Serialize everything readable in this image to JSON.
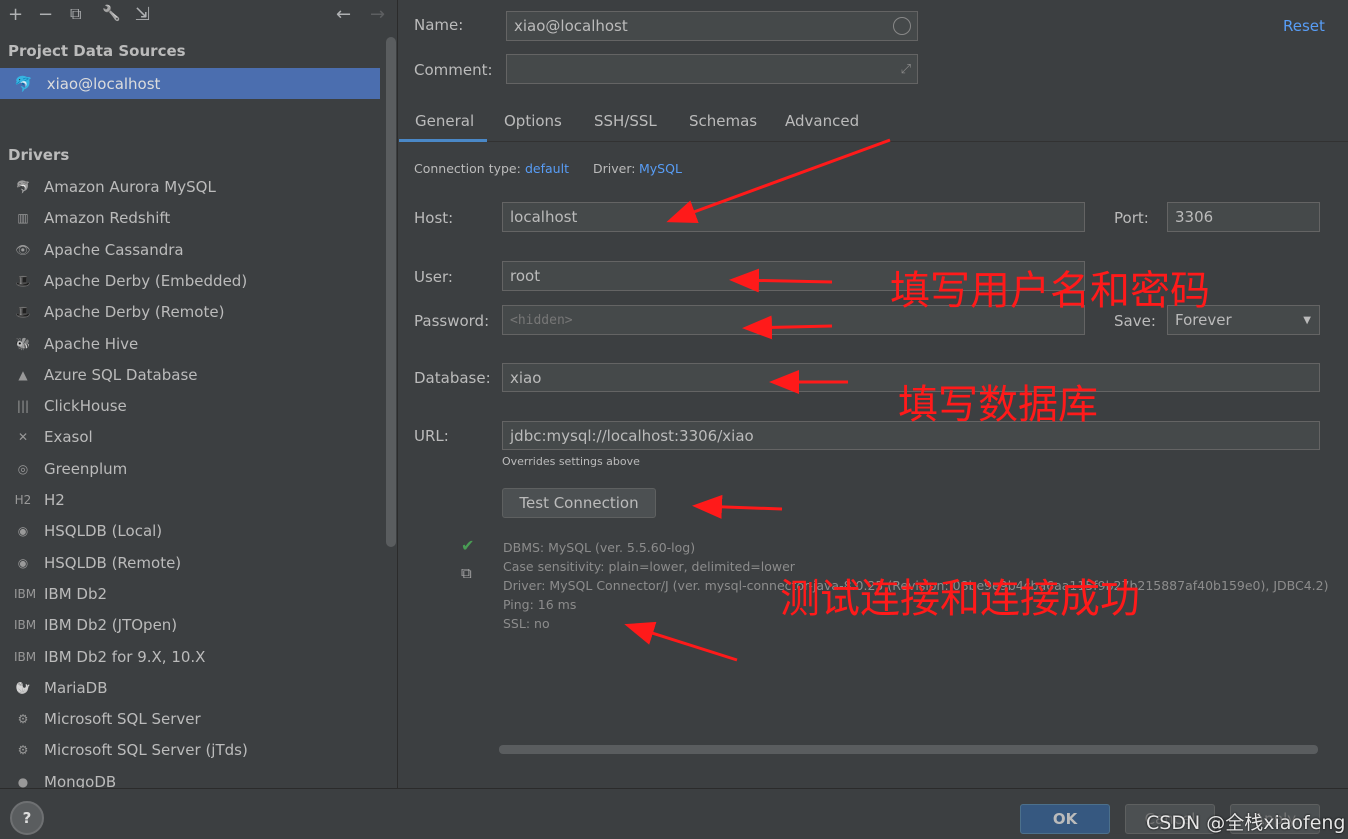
{
  "toolbar": {
    "add": "+",
    "remove": "−",
    "duplicate": "⧉",
    "settings": "🔧",
    "import": "⇲",
    "back": "←",
    "forward": "→"
  },
  "sidebar": {
    "project_title": "Project Data Sources",
    "selected": "xiao@localhost",
    "drivers_title": "Drivers",
    "drivers": [
      "Amazon Aurora MySQL",
      "Amazon Redshift",
      "Apache Cassandra",
      "Apache Derby (Embedded)",
      "Apache Derby (Remote)",
      "Apache Hive",
      "Azure SQL Database",
      "ClickHouse",
      "Exasol",
      "Greenplum",
      "H2",
      "HSQLDB (Local)",
      "HSQLDB (Remote)",
      "IBM Db2",
      "IBM Db2 (JTOpen)",
      "IBM Db2 for 9.X, 10.X",
      "MariaDB",
      "Microsoft SQL Server",
      "Microsoft SQL Server (jTds)",
      "MongoDB"
    ]
  },
  "form": {
    "name_label": "Name:",
    "name_value": "xiao@localhost",
    "comment_label": "Comment:",
    "comment_value": "",
    "reset": "Reset",
    "tabs": [
      "General",
      "Options",
      "SSH/SSL",
      "Schemas",
      "Advanced"
    ],
    "conn_type_label": "Connection type:",
    "conn_type_value": "default",
    "driver_label": "Driver:",
    "driver_value": "MySQL",
    "host_label": "Host:",
    "host_value": "localhost",
    "port_label": "Port:",
    "port_value": "3306",
    "user_label": "User:",
    "user_value": "root",
    "password_label": "Password:",
    "password_placeholder": "<hidden>",
    "save_label": "Save:",
    "save_value": "Forever",
    "database_label": "Database:",
    "database_value": "xiao",
    "url_label": "URL:",
    "url_value": "jdbc:mysql://localhost:3306/xiao",
    "url_hint": "Overrides settings above",
    "test_button": "Test Connection"
  },
  "result": [
    "DBMS: MySQL (ver. 5.5.60-log)",
    "Case sensitivity: plain=lower, delimited=lower",
    "Driver: MySQL Connector/J (ver. mysql-connector-java-8.0.25 (Revision: 08be9e9b4cba6aa115f9b27b215887af40b159e0), JDBC4.2)",
    "Ping: 16 ms",
    "SSL: no"
  ],
  "annotations": {
    "user_pass": "填写用户名和密码",
    "database": "填写数据库",
    "test": "测试连接和连接成功"
  },
  "footer": {
    "help": "?",
    "ok": "OK",
    "cancel": "Cancel",
    "apply": "Apply",
    "watermark": "CSDN @全栈xiaofeng"
  },
  "colors": {
    "accent": "#4b6eaf",
    "link": "#589df6",
    "annotation": "#ff1a1a",
    "success": "#499c54"
  }
}
